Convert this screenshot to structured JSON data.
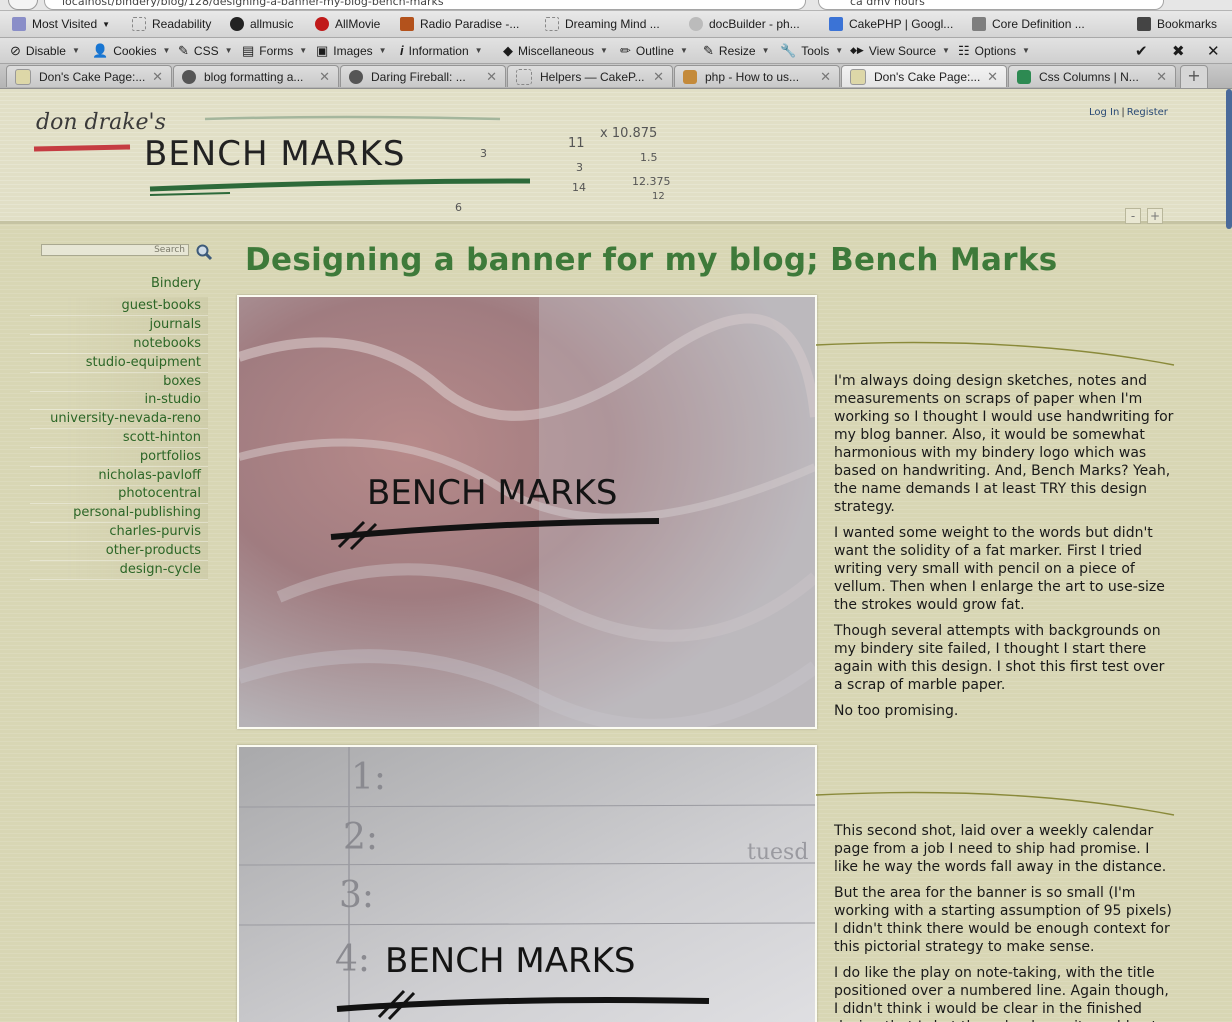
{
  "browser": {
    "url": "localhost/bindery/blog/128/designing-a-banner-my-blog-bench-marks",
    "search_query": "ca dmv hours",
    "bookmarks": [
      {
        "label": "Most Visited",
        "dropdown": true
      },
      {
        "label": "Readability"
      },
      {
        "label": "allmusic"
      },
      {
        "label": "AllMovie"
      },
      {
        "label": "Radio Paradise -..."
      },
      {
        "label": "Dreaming Mind ..."
      },
      {
        "label": "docBuilder - ph..."
      },
      {
        "label": "CakePHP | Googl..."
      },
      {
        "label": "Core Definition ..."
      },
      {
        "label": "Bookmarks",
        "dropdown": true
      }
    ],
    "toolbar": [
      {
        "label": "Disable"
      },
      {
        "label": "Cookies"
      },
      {
        "label": "CSS"
      },
      {
        "label": "Forms"
      },
      {
        "label": "Images"
      },
      {
        "label": "Information"
      },
      {
        "label": "Miscellaneous"
      },
      {
        "label": "Outline"
      },
      {
        "label": "Resize"
      },
      {
        "label": "Tools"
      },
      {
        "label": "View Source"
      },
      {
        "label": "Options"
      }
    ],
    "tabs": [
      {
        "title": "Don's Cake Page:...",
        "active": false
      },
      {
        "title": "blog formatting a...",
        "active": false
      },
      {
        "title": "Daring Fireball: ...",
        "active": false
      },
      {
        "title": "Helpers — CakeP...",
        "active": false
      },
      {
        "title": "php - How to us...",
        "active": false
      },
      {
        "title": "Don's Cake Page:...",
        "active": true
      },
      {
        "title": "Css Columns | N...",
        "active": false
      }
    ]
  },
  "header": {
    "login": "Log In",
    "separator": "|",
    "register": "Register",
    "font_decrease": "-",
    "font_increase": "+"
  },
  "sidebar": {
    "search_placeholder": "Search",
    "category": "Bindery",
    "items": [
      "guest-books",
      "journals",
      "notebooks",
      "studio-equipment",
      "boxes",
      "in-studio",
      "university-nevada-reno",
      "scott-hinton",
      "portfolios",
      "nicholas-pavloff",
      "photocentral",
      "personal-publishing",
      "charles-purvis",
      "other-products",
      "design-cycle"
    ]
  },
  "post": {
    "title": "Designing a banner for my blog; Bench Marks",
    "section1": [
      "I'm always doing design sketches, notes and measurements on scraps of paper when I'm working so I thought I would use handwriting for my blog banner. Also, it would be somewhat harmonious with my bindery logo which was based on handwriting. And, Bench Marks? Yeah, the name demands I at least TRY this design strategy.",
      "I wanted some weight to the words but didn't want the solidity of a fat marker. First I tried writing very small with pencil on a piece of vellum. Then when I enlarge the art to use-size the strokes would grow fat.",
      "Though several attempts with backgrounds on my bindery site failed, I thought I start there again with this design. I shot this first test over a scrap of marble paper.",
      "No too promising."
    ],
    "section2": [
      "This second shot, laid over a weekly calendar page from a job I need to ship had promise. I like he way the words fall away in the distance.",
      "But the area for the banner is so small (I'm working with a starting assumption of 95 pixels) I didn't think there would be enough context for this pictorial strategy to make sense.",
      "I do like the play on note-taking, with the title positioned over a numbered line. Again though, I didn't think i would be clear in the finished design that I shot the calendar as it would not be legible."
    ]
  },
  "banner": {
    "line1": "don drake's",
    "line2": "BENCH MARKS",
    "notes": [
      "11",
      "x 10.875",
      "3",
      "1.5",
      "14",
      "12.375",
      "12"
    ],
    "photo1_text": "BENCH MARKS",
    "photo2_text": "BENCH MARKS",
    "photo2_numbers": [
      "1:",
      "2:",
      "3:",
      "4:"
    ],
    "photo2_side": "tuesd"
  },
  "colors": {
    "page_bg": "#d8d6b4",
    "title_green": "#3e7a3a",
    "nav_green": "#2c6627",
    "link_blue": "#2a4a75"
  }
}
